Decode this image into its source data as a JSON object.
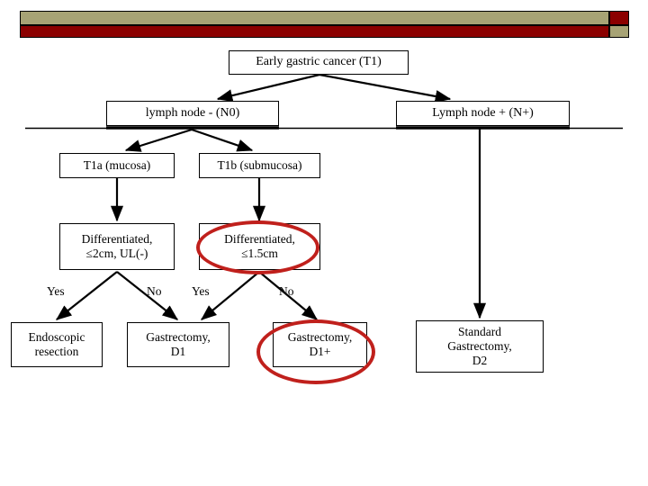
{
  "header": {
    "bar_olive_color": "#a7a375",
    "bar_red_color": "#8b0000"
  },
  "diagram": {
    "title": "Early gastric cancer (T1)",
    "nodes": {
      "title": "Early gastric cancer (T1)",
      "lymph_node_negative": "lymph node - (N0)",
      "lymph_node_positive": "Lymph node + (N+)",
      "t1a": "T1a (mucosa)",
      "t1b": "T1b (submucosa)",
      "diff_2cm_line1": "Differentiated,",
      "diff_2cm_line2": "≤2cm, UL(-)",
      "diff_15cm_line1": "Differentiated,",
      "diff_15cm_line2": "≤1.5cm",
      "endoscopic_line1": "Endoscopic",
      "endoscopic_line2": "resection",
      "gastrectomy_d1_line1": "Gastrectomy,",
      "gastrectomy_d1_line2": "D1",
      "gastrectomy_d1plus_line1": "Gastrectomy,",
      "gastrectomy_d1plus_line2": "D1+",
      "standard_gastrectomy_d2_line1": "Standard",
      "standard_gastrectomy_d2_line2": "Gastrectomy,",
      "standard_gastrectomy_d2_line3": "D2"
    },
    "branch_labels": {
      "yes_left": "Yes",
      "no_left": "No",
      "yes_right": "Yes",
      "no_right": "No"
    },
    "highlight_color": "#c0201c",
    "highlighted_nodes": [
      "diff_15cm",
      "gastrectomy_d1plus"
    ]
  }
}
